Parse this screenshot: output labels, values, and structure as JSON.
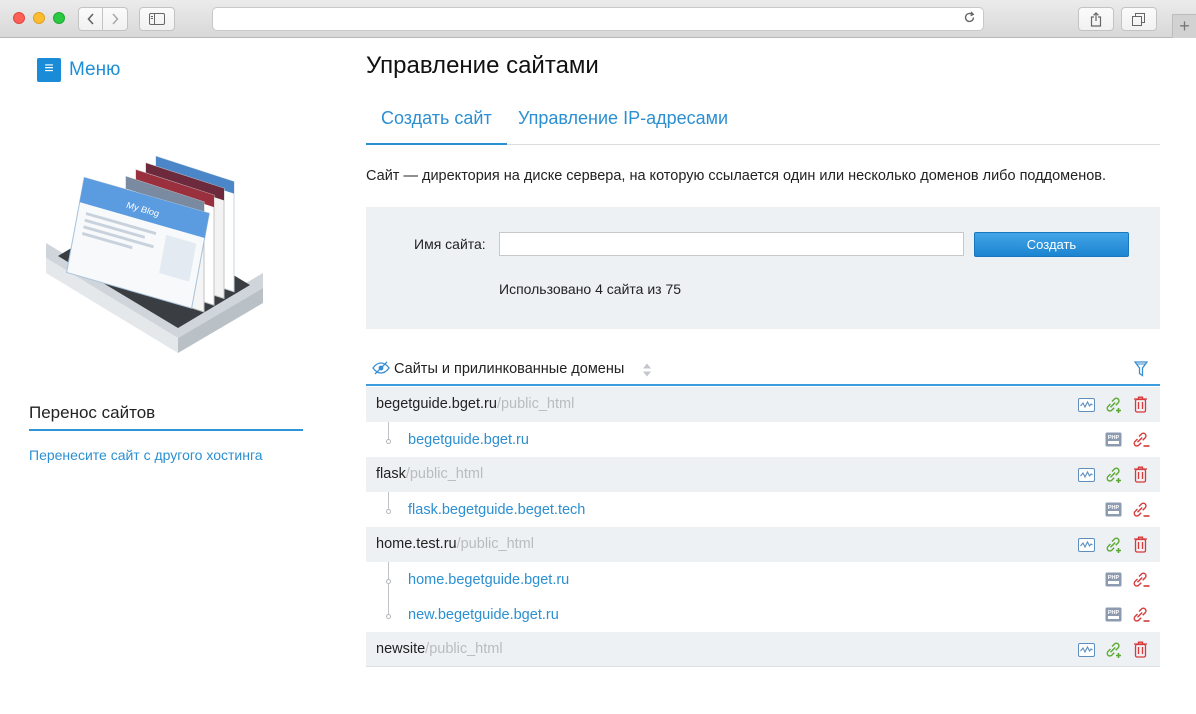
{
  "menu": {
    "label": "Меню"
  },
  "transfer": {
    "title": "Перенос сайтов",
    "link": "Перенесите сайт с другого хостинга"
  },
  "hero": {
    "blog_title": "My Blog"
  },
  "page": {
    "title": "Управление сайтами"
  },
  "tabs": [
    {
      "label": "Создать сайт",
      "active": true
    },
    {
      "label": "Управление IP-адресами",
      "active": false
    }
  ],
  "description": "Сайт — директория на диске сервера, на которую ссылается один или несколько доменов либо поддоменов.",
  "create_form": {
    "name_label": "Имя сайта:",
    "name_value": "",
    "button_label": "Создать",
    "usage_text": "Использовано 4 сайта из 75"
  },
  "list": {
    "title": "Сайты и прилинкованные домены",
    "sites": [
      {
        "name": "begetguide.bget.ru",
        "path": "/public_html",
        "domains": [
          "begetguide.bget.ru"
        ]
      },
      {
        "name": "flask",
        "path": "/public_html",
        "domains": [
          "flask.begetguide.beget.tech"
        ]
      },
      {
        "name": "home.test.ru",
        "path": "/public_html",
        "domains": [
          "home.begetguide.bget.ru",
          "new.begetguide.bget.ru"
        ]
      },
      {
        "name": "newsite",
        "path": "/public_html",
        "domains": []
      }
    ]
  },
  "colors": {
    "accent": "#2b8fd1",
    "button": "#1c84d0",
    "panel": "#eef1f4",
    "link_green": "#5aa832",
    "delete_red": "#d63a3a"
  },
  "icons": {
    "site_actions": [
      "stats-icon",
      "link-domain-icon",
      "delete-icon"
    ],
    "domain_actions": [
      "php-icon",
      "unlink-icon"
    ]
  }
}
